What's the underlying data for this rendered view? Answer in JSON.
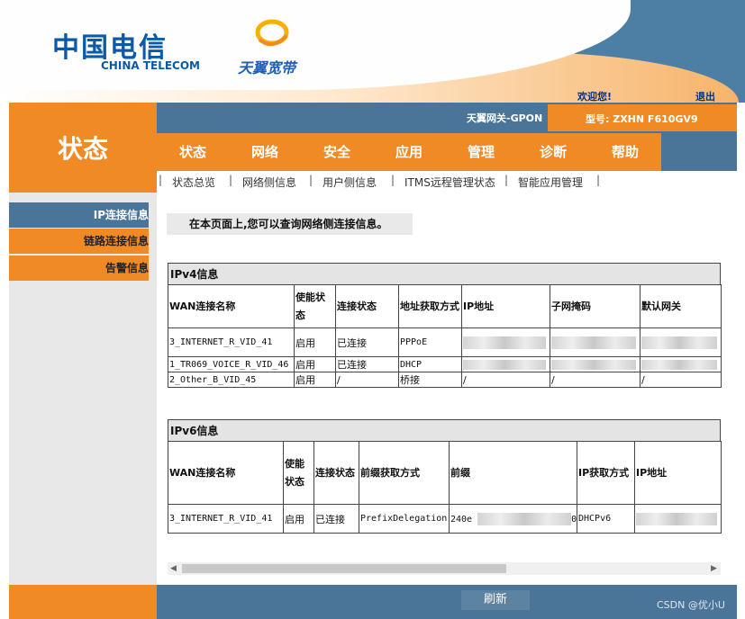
{
  "header": {
    "brand_cn": "中国电信",
    "brand_en": "CHINA TELECOM",
    "sub_brand": "天翼宽带",
    "welcome": "欢迎您!",
    "logout": "退出",
    "gateway_title": "天翼网关-GPON",
    "model": "型号: ZXHN F610GV9"
  },
  "section": {
    "title": "状态"
  },
  "tabs": [
    "状态",
    "网络",
    "安全",
    "应用",
    "管理",
    "诊断",
    "帮助"
  ],
  "subnav": [
    "状态总览",
    "网络侧信息",
    "用户侧信息",
    "ITMS远程管理状态",
    "智能应用管理"
  ],
  "sidebar": [
    "IP连接信息",
    "链路连接信息",
    "告警信息"
  ],
  "main": {
    "info": "在本页面上,您可以查询网络侧连接信息。",
    "ipv4": {
      "title": "IPv4信息",
      "headers": [
        "WAN连接名称",
        "使能状态",
        "连接状态",
        "地址获取方式",
        "IP地址",
        "子网掩码",
        "默认网关"
      ],
      "rows": [
        [
          "3_INTERNET_R_VID_41",
          "启用",
          "已连接",
          "PPPoE",
          "",
          "",
          ""
        ],
        [
          "1_TR069_VOICE_R_VID_46",
          "启用",
          "已连接",
          "DHCP",
          "",
          "",
          ""
        ],
        [
          "2_Other_B_VID_45",
          "启用",
          "/",
          "桥接",
          "/",
          "/",
          "/"
        ]
      ]
    },
    "ipv6": {
      "title": "IPv6信息",
      "headers": [
        "WAN连接名称",
        "使能状态",
        "连接状态",
        "前缀获取方式",
        "前缀",
        "IP获取方式",
        "IP地址"
      ],
      "rows": [
        [
          "3_INTERNET_R_VID_41",
          "启用",
          "已连接",
          "PrefixDelegation",
          "240e",
          "0",
          "DHCPv6"
        ]
      ]
    }
  },
  "footer": {
    "refresh": "刷新",
    "watermark": "CSDN @优小U"
  },
  "colors": {
    "orange": "#f08a24",
    "slate_blue": "#4a7598",
    "brand_blue": "#0b5aa8"
  }
}
